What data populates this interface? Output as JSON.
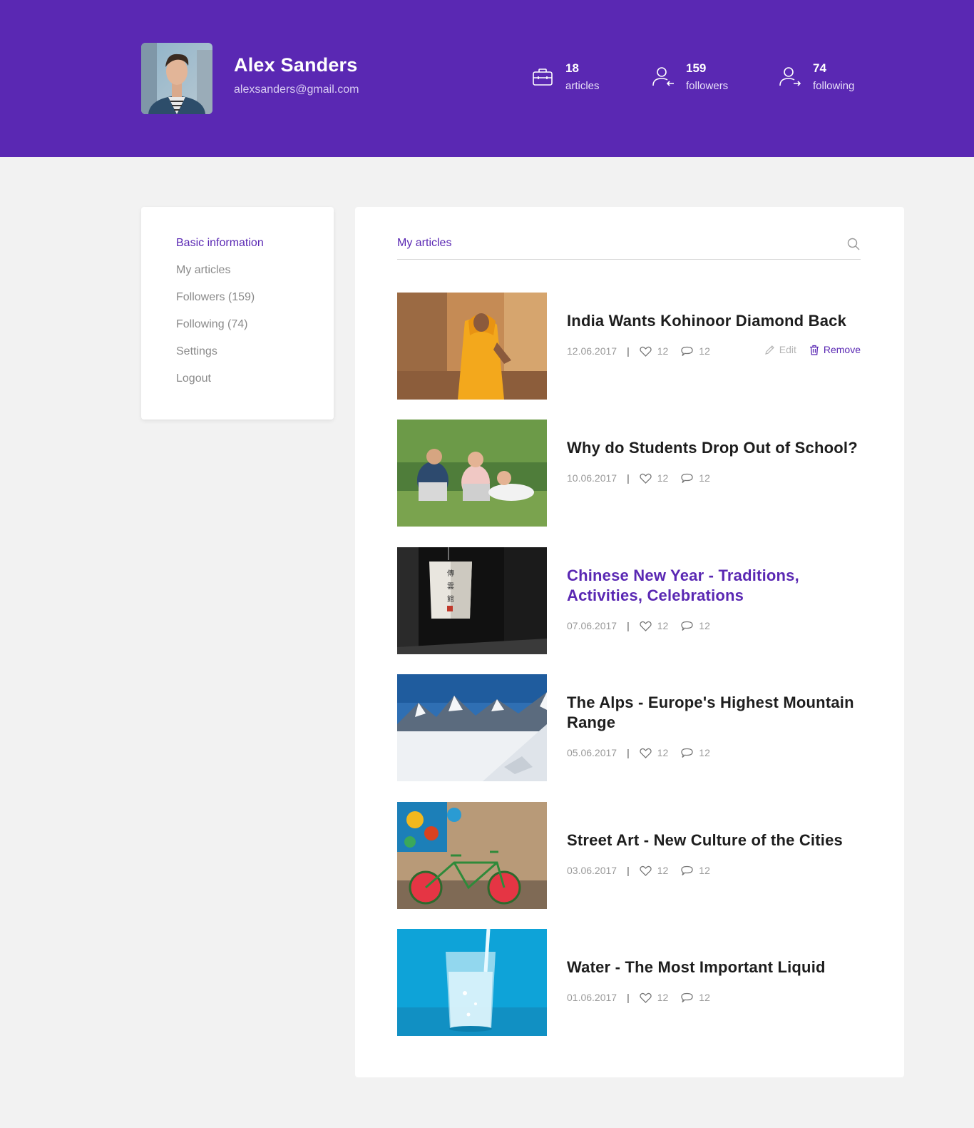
{
  "profile": {
    "name": "Alex Sanders",
    "email": "alexsanders@gmail.com"
  },
  "stats": [
    {
      "icon": "briefcase-icon",
      "value": "18",
      "label": "articles"
    },
    {
      "icon": "followers-icon",
      "value": "159",
      "label": "followers"
    },
    {
      "icon": "following-icon",
      "value": "74",
      "label": "following"
    }
  ],
  "sidebar": {
    "items": [
      {
        "label": "Basic information",
        "active": true
      },
      {
        "label": "My articles",
        "active": false
      },
      {
        "label": "Followers (159)",
        "active": false
      },
      {
        "label": "Following (74)",
        "active": false
      },
      {
        "label": "Settings",
        "active": false
      },
      {
        "label": "Logout",
        "active": false
      }
    ]
  },
  "main": {
    "tab_title": "My articles",
    "articles": [
      {
        "title": "India Wants Kohinoor Diamond Back",
        "date": "12.06.2017",
        "likes": "12",
        "comments": "12",
        "edit_label": "Edit",
        "remove_label": "Remove"
      },
      {
        "title": "Why do Students Drop Out of School?",
        "date": "10.06.2017",
        "likes": "12",
        "comments": "12"
      },
      {
        "title": "Chinese New Year - Traditions, Activities, Celebrations",
        "date": "07.06.2017",
        "likes": "12",
        "comments": "12"
      },
      {
        "title": "The Alps - Europe's Highest Mountain Range",
        "date": "05.06.2017",
        "likes": "12",
        "comments": "12"
      },
      {
        "title": "Street Art - New Culture of the Cities",
        "date": "03.06.2017",
        "likes": "12",
        "comments": "12"
      },
      {
        "title": "Water - The Most Important Liquid",
        "date": "01.06.2017",
        "likes": "12",
        "comments": "12"
      }
    ]
  },
  "colors": {
    "brand": "#5a28b3",
    "page_background": "#f2f2f2"
  }
}
